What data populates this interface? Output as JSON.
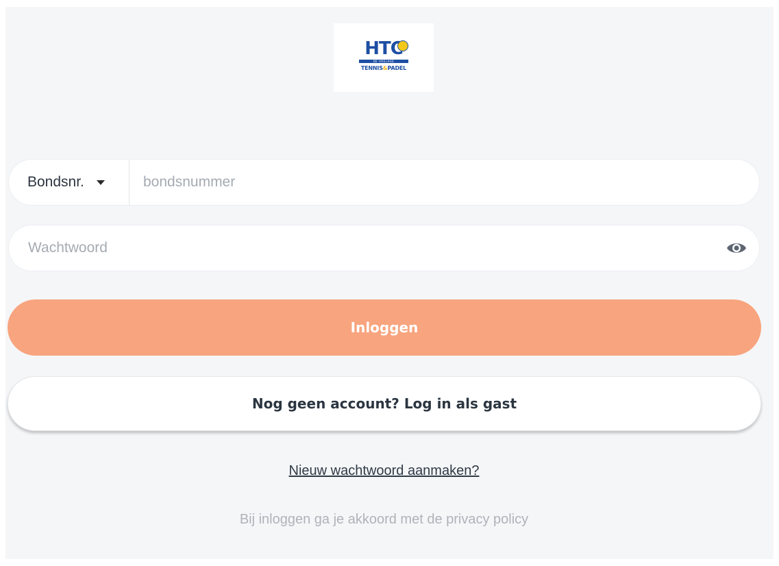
{
  "logo": {
    "letters": "HTC",
    "stripe_text": "DE VRELAGE",
    "sub_text_left": "TENNIS",
    "sub_text_amp": "&",
    "sub_text_right": "PADEL",
    "primary_color": "#1d4fa3",
    "accent_color": "#f2c81b"
  },
  "login_form": {
    "id_type_select": {
      "selected": "Bondsnr.",
      "icon": "caret-down-icon"
    },
    "bondsnummer_input": {
      "value": "",
      "placeholder": "bondsnummer"
    },
    "password_input": {
      "value": "",
      "placeholder": "Wachtwoord",
      "toggle_icon": "eye-icon"
    },
    "login_button": {
      "label": "Inloggen",
      "color": "#f8a47e"
    },
    "guest_button": {
      "label": "Nog geen account? Log in als gast"
    },
    "reset_password_link": "Nieuw wachtwoord aanmaken?",
    "privacy_note": "Bij inloggen ga je akkoord met de privacy policy"
  }
}
